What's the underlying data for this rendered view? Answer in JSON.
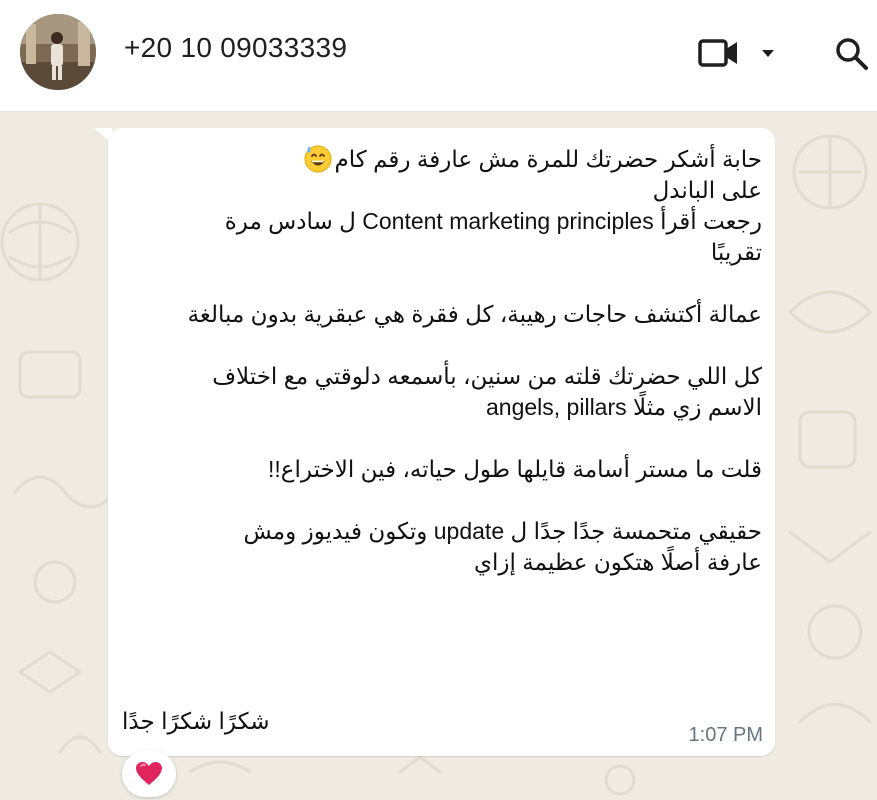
{
  "header": {
    "contact_number": "+20 10 09033339",
    "avatar_icon": "contact-avatar",
    "video_call_icon": "video-camera-icon",
    "dropdown_icon": "caret-down-icon",
    "search_icon": "search-icon"
  },
  "message": {
    "lines": [
      "حابة أشكر حضرتك للمرة مش عارفة رقم كام",
      "على الباندل",
      "رجعت أقرأ Content marketing principles ل سادس مرة",
      "تقريبًا",
      "",
      "عمالة أكتشف حاجات رهيبة، كل فقرة هي عبقرية بدون مبالغة",
      "",
      "كل اللي حضرتك قلته من سنين، بأسمعه دلوقتي مع اختلاف",
      "الاسم زي مثلًا angels, pillars",
      "",
      "قلت ما مستر أسامة قايلها طول حياته، فين الاختراع!!",
      "",
      "حقيقي متحمسة جدًا جدًا ل update  وتكون فيديوز ومش",
      "عارفة أصلًا هتكون عظيمة إزاي",
      "",
      "شكرًا شكرًا جدًا"
    ],
    "emoji": "grinning-face-with-sweat",
    "time": "1:07 PM",
    "reaction": "red-heart"
  },
  "colors": {
    "background": "#efeae2",
    "bubble": "#ffffff",
    "time": "#667781",
    "heart": "#e0245e"
  }
}
